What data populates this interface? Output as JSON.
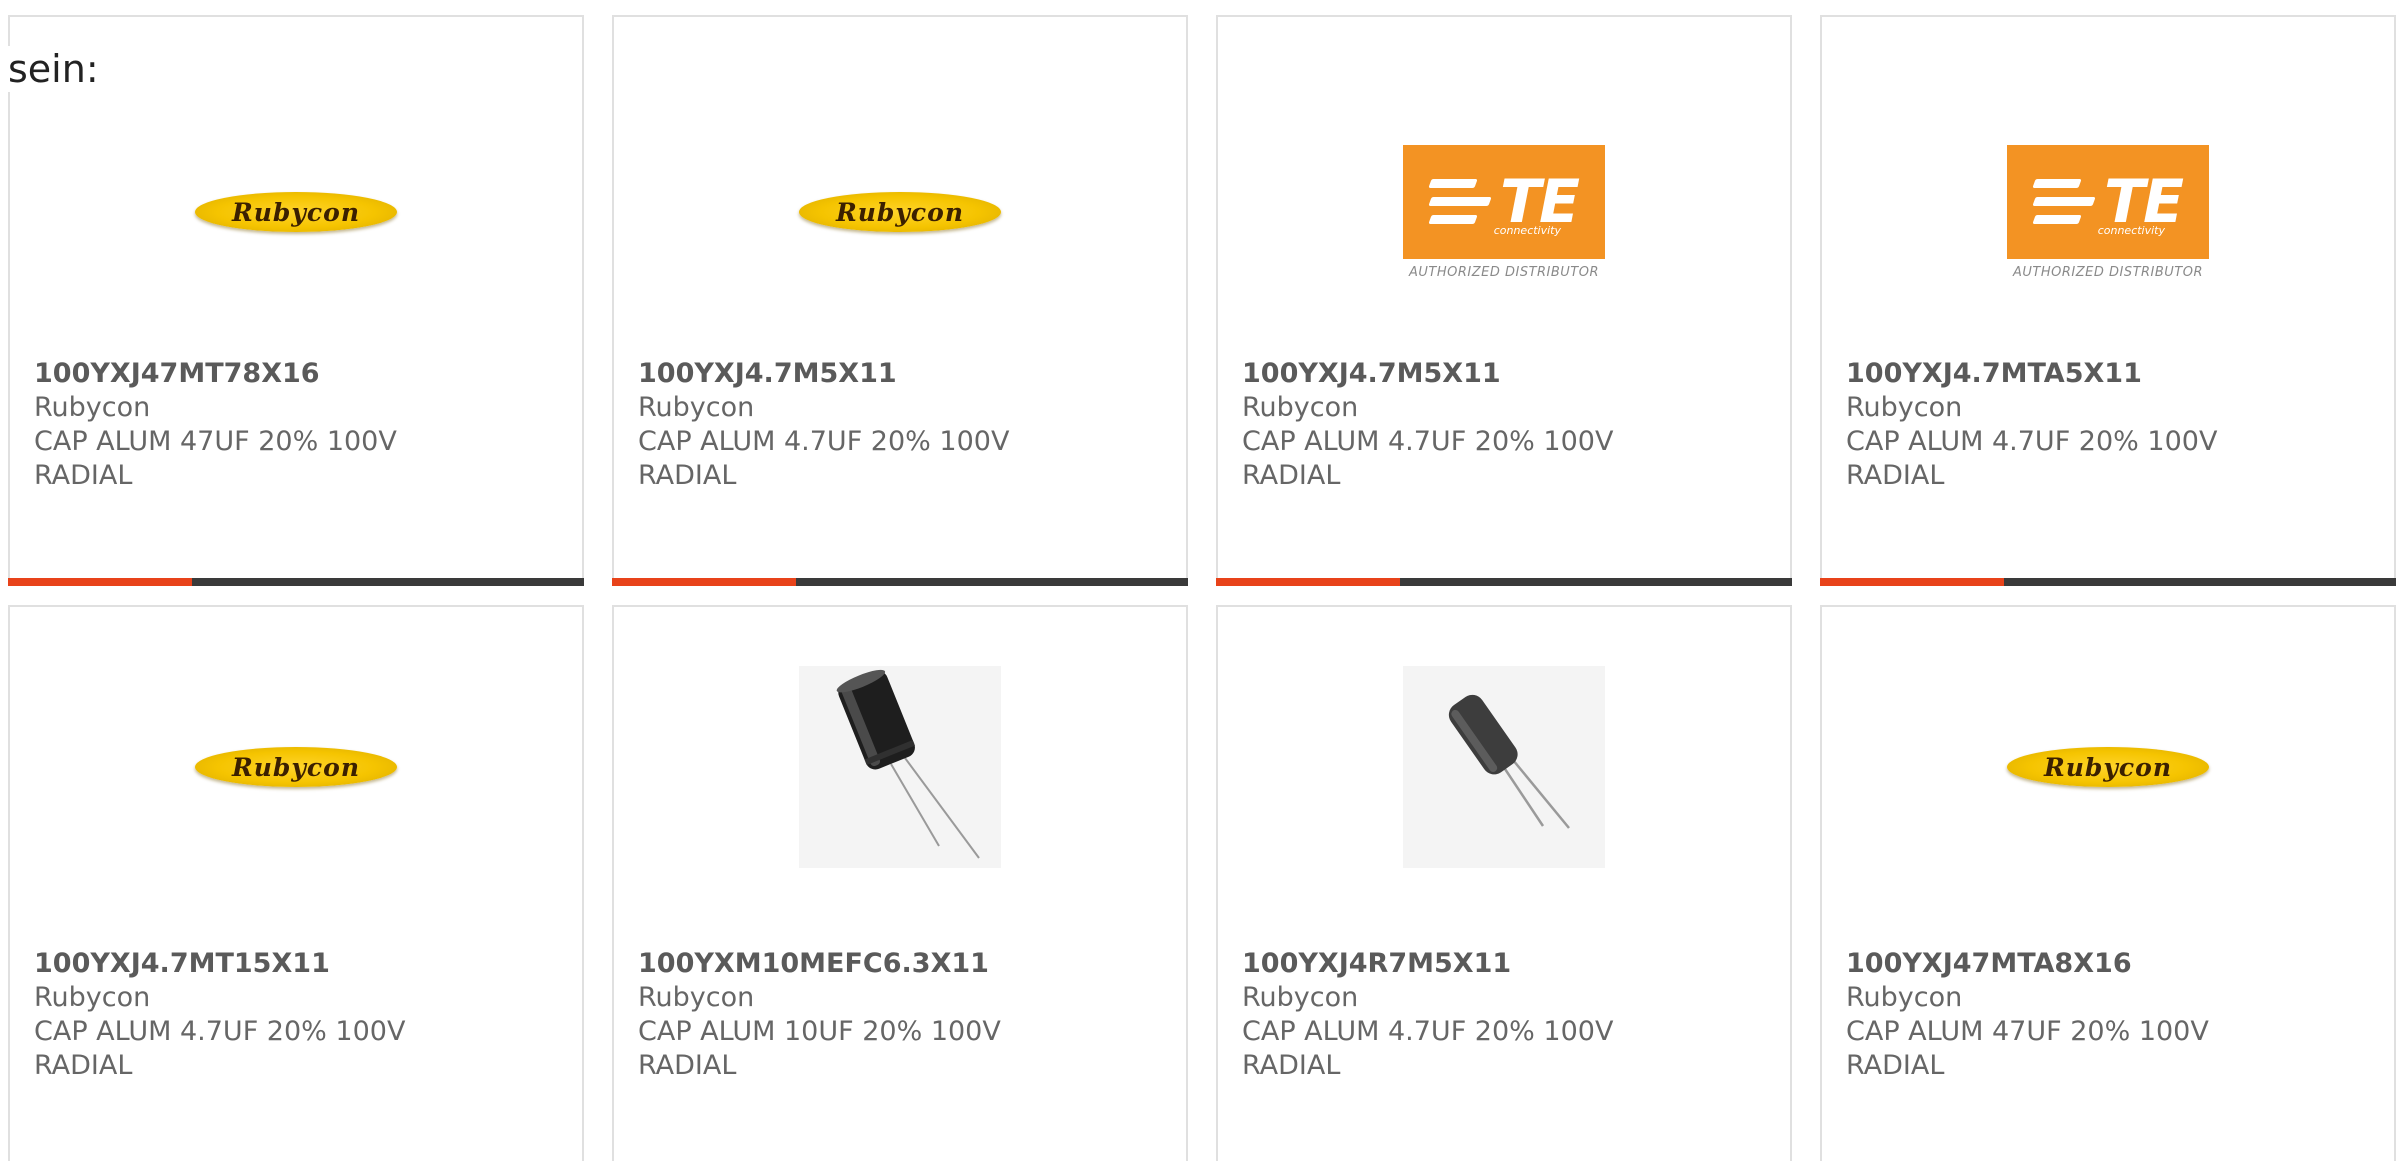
{
  "heading": "sein:",
  "colors": {
    "accent": "#e8431a",
    "track": "#3a3a3a",
    "border": "#e0e0e0",
    "rubycon_yellow": "#f5c400",
    "te_orange": "#f39323"
  },
  "logos": {
    "rubycon": "Rubycon",
    "te": "TE",
    "te_sub": "connectivity",
    "te_distributor": "AUTHORIZED DISTRIBUTOR"
  },
  "products": [
    {
      "part_number": "100YXJ47MT78X16",
      "manufacturer": "Rubycon",
      "desc_line1": "CAP ALUM 47UF 20% 100V",
      "desc_line2": "RADIAL",
      "image": "rubycon-logo",
      "progress": 0.32
    },
    {
      "part_number": "100YXJ4.7M5X11",
      "manufacturer": "Rubycon",
      "desc_line1": "CAP ALUM 4.7UF 20% 100V",
      "desc_line2": "RADIAL",
      "image": "rubycon-logo",
      "progress": 0.32
    },
    {
      "part_number": "100YXJ4.7M5X11",
      "manufacturer": "Rubycon",
      "desc_line1": "CAP ALUM 4.7UF 20% 100V",
      "desc_line2": "RADIAL",
      "image": "te-logo",
      "progress": 0.32
    },
    {
      "part_number": "100YXJ4.7MTA5X11",
      "manufacturer": "Rubycon",
      "desc_line1": "CAP ALUM 4.7UF 20% 100V",
      "desc_line2": "RADIAL",
      "image": "te-logo",
      "progress": 0.32
    },
    {
      "part_number": "100YXJ4.7MT15X11",
      "manufacturer": "Rubycon",
      "desc_line1": "CAP ALUM 4.7UF 20% 100V",
      "desc_line2": "RADIAL",
      "image": "rubycon-logo"
    },
    {
      "part_number": "100YXM10MEFC6.3X11",
      "manufacturer": "Rubycon",
      "desc_line1": "CAP ALUM 10UF 20% 100V",
      "desc_line2": "RADIAL",
      "image": "capacitor-photo"
    },
    {
      "part_number": "100YXJ4R7M5X11",
      "manufacturer": "Rubycon",
      "desc_line1": "CAP ALUM 4.7UF 20% 100V",
      "desc_line2": "RADIAL",
      "image": "capacitor-photo-small"
    },
    {
      "part_number": "100YXJ47MTA8X16",
      "manufacturer": "Rubycon",
      "desc_line1": "CAP ALUM 47UF 20% 100V",
      "desc_line2": "RADIAL",
      "image": "rubycon-logo"
    }
  ]
}
